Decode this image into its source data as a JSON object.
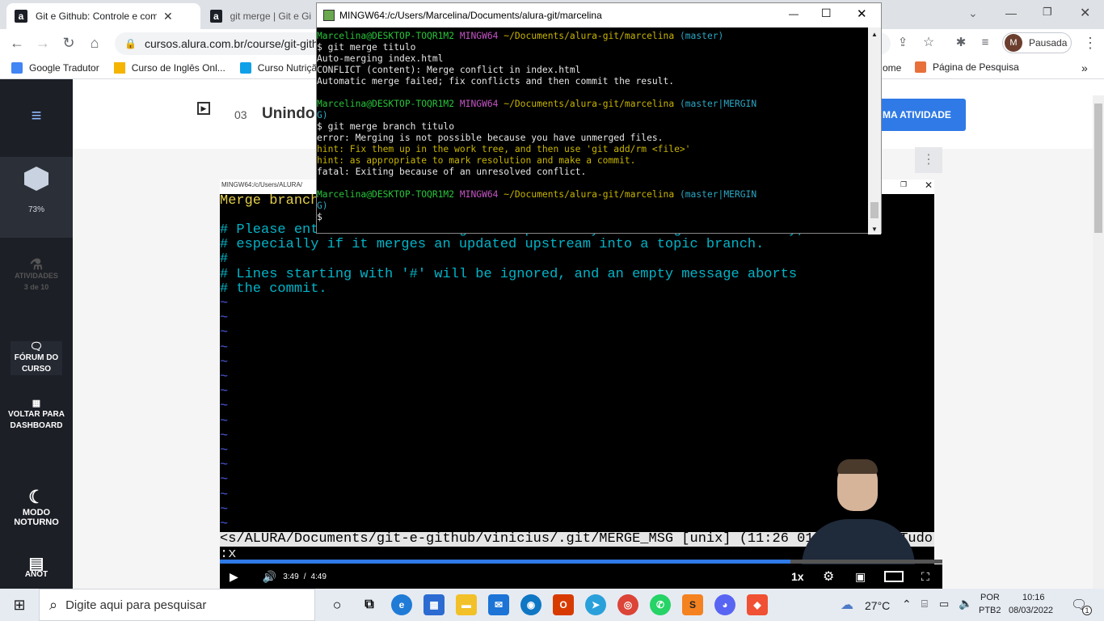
{
  "browser": {
    "tabs": [
      {
        "label": "Git e Github: Controle e compart",
        "favicon": "a"
      },
      {
        "label": "git merge | Git e Gith",
        "favicon": "a"
      }
    ],
    "url": "cursos.alura.com.br/course/git-gith",
    "profile_status": "Pausada",
    "profile_initial": "M",
    "bookmarks": [
      "Google Tradutor",
      "Curso de Inglês Onl...",
      "Curso Nutriçã",
      "ome",
      "Página de Pesquisa"
    ]
  },
  "sidebar": {
    "progress": "73%",
    "activities_label": "ATIVIDADES",
    "activities_count": "3 de 10",
    "forum": "FÓRUM DO CURSO",
    "dashboard": "VOLTAR PARA DASHBOARD",
    "night_mode": "MODO NOTURNO",
    "bottom_label": "ANOT"
  },
  "lesson": {
    "number": "03",
    "title": "Unindo",
    "next_button": "MA ATIVIDADE"
  },
  "video": {
    "title_bar": "MINGW64:/c/Users/ALURA/",
    "vim_lines": [
      "Merge branch",
      "# Please enter a commit message to explain why this merge is necessary,",
      "# especially if it merges an updated upstream into a topic branch.",
      "#",
      "# Lines starting with '#' will be ignored, and an empty message aborts",
      "# the commit."
    ],
    "status_line": "<s/ALURA/Documents/git-e-github/vinicius/.git/MERGE_MSG [unix] (11:26 01/0",
    "status_right": "Tudo",
    "command_line": ":x",
    "time_current": "3:49",
    "time_total": "4:49",
    "speed": "1x",
    "progress": 0.79
  },
  "terminal": {
    "title": "MINGW64:/c/Users/Marcelina/Documents/alura-git/marcelina",
    "user": "Marcelina@DESKTOP-TOQR1M2",
    "env": "MINGW64",
    "path": "~/Documents/alura-git/marcelina",
    "branch1": "(master)",
    "cmd1": "$ git merge titulo",
    "out1": [
      "Auto-merging index.html",
      "CONFLICT (content): Merge conflict in index.html",
      "Automatic merge failed; fix conflicts and then commit the result."
    ],
    "branch2a": "(master|MERGIN",
    "branch2b": "G)",
    "cmd2": "$ git merge branch titulo",
    "err1": "error: Merging is not possible because you have unmerged files.",
    "hint1": "hint: Fix them up in the work tree, and then use 'git add/rm <file>'",
    "hint2": "hint: as appropriate to mark resolution and make a commit.",
    "fatal": "fatal: Exiting because of an unresolved conflict.",
    "prompt3": "$"
  },
  "taskbar": {
    "search_placeholder": "Digite aqui para pesquisar",
    "temperature": "27°C",
    "language": "POR",
    "layout": "PTB2",
    "time": "10:16",
    "date": "08/03/2022",
    "notification_count": "1"
  }
}
